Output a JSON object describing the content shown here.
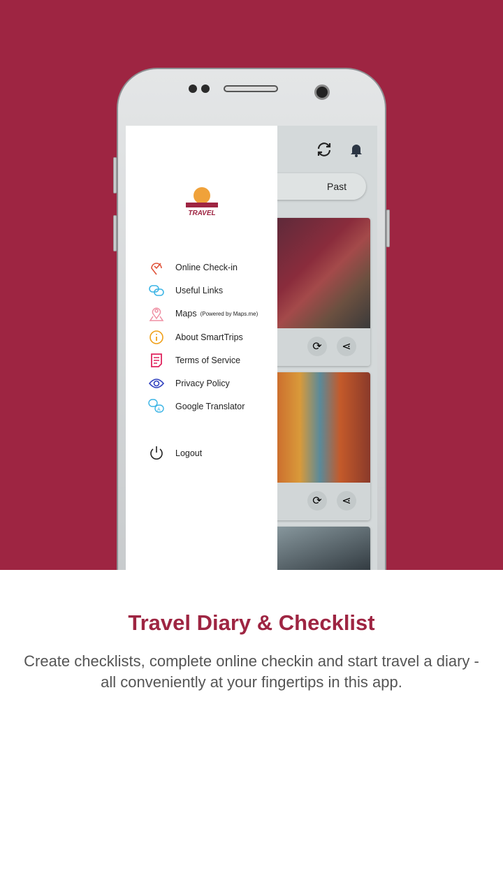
{
  "colors": {
    "brand": "#9e2542",
    "drawer": "#ffffff",
    "screen": "#d4d9da"
  },
  "app": {
    "appbar": {
      "icons": [
        "refresh-icon",
        "bell-icon"
      ]
    },
    "segment": {
      "active_label": "Past"
    },
    "drawer": {
      "logo_text": "TRAVEL",
      "items": [
        {
          "label": "Online Check-in",
          "icon": "check-pin-icon",
          "color": "#e0533a"
        },
        {
          "label": "Useful Links",
          "icon": "link-icon",
          "color": "#3bb4e5"
        },
        {
          "label": "Maps",
          "sub": "(Powered by Maps.me)",
          "icon": "map-pin-icon",
          "color": "#ef8fa3"
        },
        {
          "label": "About SmartTrips",
          "icon": "info-icon",
          "color": "#f0a019"
        },
        {
          "label": "Terms of Service",
          "icon": "document-icon",
          "color": "#e0245e"
        },
        {
          "label": "Privacy Policy",
          "icon": "eye-icon",
          "color": "#2e3fbf"
        },
        {
          "label": "Google Translator",
          "icon": "translate-icon",
          "color": "#3bb4e5"
        }
      ],
      "logout": {
        "label": "Logout",
        "icon": "power-icon"
      }
    }
  },
  "promo": {
    "title": "Travel Diary & Checklist",
    "description": "Create checklists, complete online checkin and start travel a diary - all conveniently at your fingertips in this app."
  }
}
